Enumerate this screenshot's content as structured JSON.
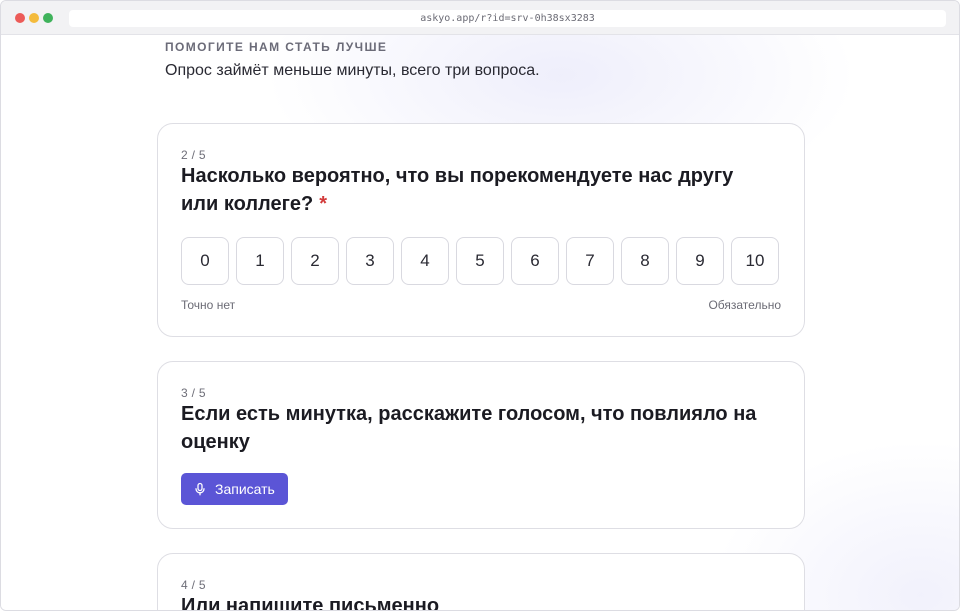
{
  "browser": {
    "url": "askyo.app/r?id=srv-0h38sx3283"
  },
  "survey": {
    "eyebrow": "ПОМОГИТЕ НАМ СТАТЬ ЛУЧШЕ",
    "intro": "Опрос займёт меньше минуты, всего три вопроса."
  },
  "questions": [
    {
      "number": "2 / 5",
      "title": "Насколько вероятно, что вы порекомендуете нас другу или коллеге?",
      "required_mark": "*",
      "scale": [
        "0",
        "1",
        "2",
        "3",
        "4",
        "5",
        "6",
        "7",
        "8",
        "9",
        "10"
      ],
      "hint_left": "Точно нет",
      "hint_right": "Обязательно"
    },
    {
      "number": "3 / 5",
      "title": "Если есть минутка, расскажите голосом, что повлияло на оценку",
      "button_label": "Записать",
      "button_icon": "microphone-icon"
    },
    {
      "number": "4 / 5",
      "title": "Или напишите письменно"
    }
  ],
  "colors": {
    "accent": "#5b55d6",
    "required": "#d23a3a"
  }
}
